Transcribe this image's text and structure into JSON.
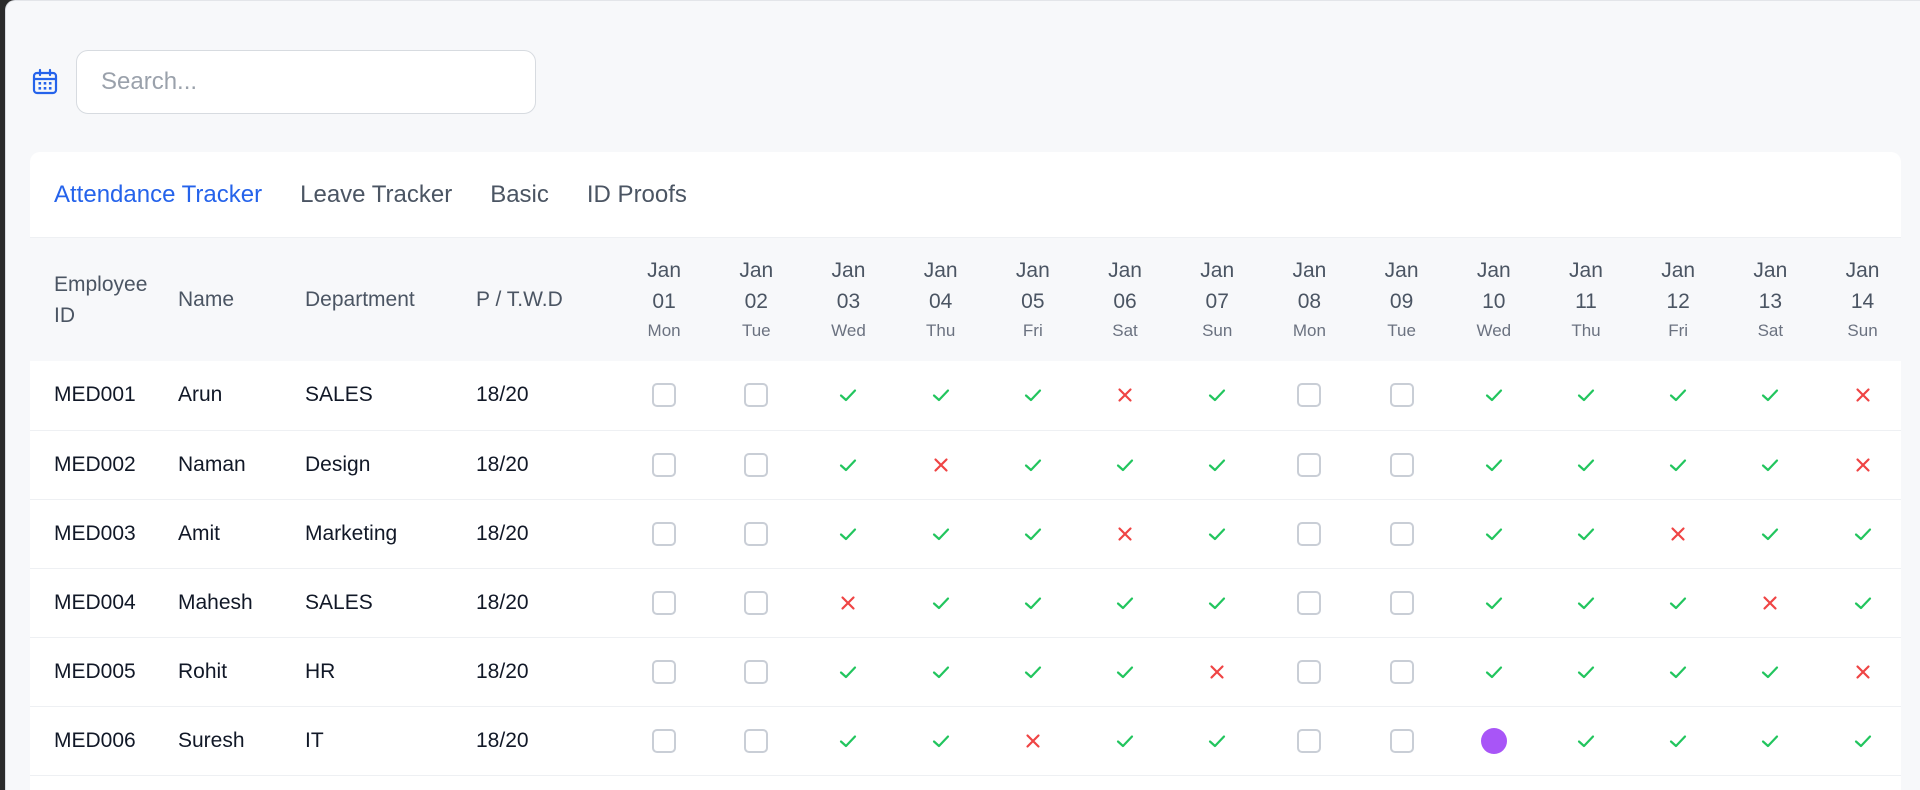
{
  "search": {
    "placeholder": "Search...",
    "value": ""
  },
  "icons": {
    "calendar": "calendar-icon",
    "present": "check-icon",
    "absent": "x-icon",
    "unmarked": "empty-checkbox",
    "leave": "purple-dot"
  },
  "colors": {
    "accent": "#2563eb",
    "present": "#22c55e",
    "absent": "#ef4444",
    "leave": "#a855f7"
  },
  "tabs": [
    {
      "label": "Attendance Tracker",
      "active": true
    },
    {
      "label": "Leave Tracker",
      "active": false
    },
    {
      "label": "Basic",
      "active": false
    },
    {
      "label": "ID Proofs",
      "active": false
    }
  ],
  "table": {
    "headers": {
      "employee_id_line1": "Employee",
      "employee_id_line2": "ID",
      "name": "Name",
      "department": "Department",
      "ptwd": "P / T.W.D"
    },
    "days": [
      {
        "month": "Jan",
        "date": "01",
        "weekday": "Mon"
      },
      {
        "month": "Jan",
        "date": "02",
        "weekday": "Tue"
      },
      {
        "month": "Jan",
        "date": "03",
        "weekday": "Wed"
      },
      {
        "month": "Jan",
        "date": "04",
        "weekday": "Thu"
      },
      {
        "month": "Jan",
        "date": "05",
        "weekday": "Fri"
      },
      {
        "month": "Jan",
        "date": "06",
        "weekday": "Sat"
      },
      {
        "month": "Jan",
        "date": "07",
        "weekday": "Sun"
      },
      {
        "month": "Jan",
        "date": "08",
        "weekday": "Mon"
      },
      {
        "month": "Jan",
        "date": "09",
        "weekday": "Tue"
      },
      {
        "month": "Jan",
        "date": "10",
        "weekday": "Wed"
      },
      {
        "month": "Jan",
        "date": "11",
        "weekday": "Thu"
      },
      {
        "month": "Jan",
        "date": "12",
        "weekday": "Fri"
      },
      {
        "month": "Jan",
        "date": "13",
        "weekday": "Sat"
      },
      {
        "month": "Jan",
        "date": "14",
        "weekday": "Sun"
      }
    ],
    "rows": [
      {
        "id": "MED001",
        "name": "Arun",
        "department": "SALES",
        "ptwd": "18/20",
        "attendance": [
          "empty",
          "empty",
          "present",
          "present",
          "present",
          "absent",
          "present",
          "empty",
          "empty",
          "present",
          "present",
          "present",
          "present",
          "absent"
        ]
      },
      {
        "id": "MED002",
        "name": "Naman",
        "department": "Design",
        "ptwd": "18/20",
        "attendance": [
          "empty",
          "empty",
          "present",
          "absent",
          "present",
          "present",
          "present",
          "empty",
          "empty",
          "present",
          "present",
          "present",
          "present",
          "absent"
        ]
      },
      {
        "id": "MED003",
        "name": "Amit",
        "department": "Marketing",
        "ptwd": "18/20",
        "attendance": [
          "empty",
          "empty",
          "present",
          "present",
          "present",
          "absent",
          "present",
          "empty",
          "empty",
          "present",
          "present",
          "absent",
          "present",
          "present"
        ]
      },
      {
        "id": "MED004",
        "name": "Mahesh",
        "department": "SALES",
        "ptwd": "18/20",
        "attendance": [
          "empty",
          "empty",
          "absent",
          "present",
          "present",
          "present",
          "present",
          "empty",
          "empty",
          "present",
          "present",
          "present",
          "absent",
          "present"
        ]
      },
      {
        "id": "MED005",
        "name": "Rohit",
        "department": "HR",
        "ptwd": "18/20",
        "attendance": [
          "empty",
          "empty",
          "present",
          "present",
          "present",
          "present",
          "absent",
          "empty",
          "empty",
          "present",
          "present",
          "present",
          "present",
          "absent"
        ]
      },
      {
        "id": "MED006",
        "name": "Suresh",
        "department": "IT",
        "ptwd": "18/20",
        "attendance": [
          "empty",
          "empty",
          "present",
          "present",
          "absent",
          "present",
          "present",
          "empty",
          "empty",
          "leave",
          "present",
          "present",
          "present",
          "present"
        ]
      }
    ]
  }
}
